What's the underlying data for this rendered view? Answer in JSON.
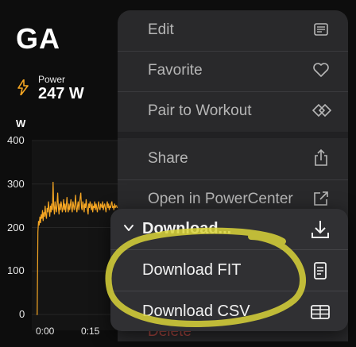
{
  "page": {
    "title": "GA",
    "power": {
      "label": "Power",
      "value": "247 W",
      "icon": "lightning-icon"
    },
    "unit": "W"
  },
  "chart_data": {
    "type": "line",
    "ylabel": "W",
    "yticks": [
      "400",
      "300",
      "200",
      "100",
      "0"
    ],
    "xticks": [
      "0:00",
      "0:15"
    ],
    "ylim": [
      0,
      400
    ],
    "series": [
      {
        "color": "#f5a623",
        "x_minutes": [
          0,
          0.2,
          0.4,
          0.6,
          0.8,
          1,
          1.2,
          1.4,
          1.6,
          1.8,
          2,
          2.2,
          2.4,
          2.6,
          2.8,
          3,
          3.2,
          3.4,
          3.6,
          3.8,
          4,
          4.2,
          4.4,
          4.6,
          4.8,
          5,
          5.2,
          5.4,
          5.6,
          5.8,
          6,
          6.2,
          6.4,
          6.6,
          6.8,
          7,
          7.2,
          7.4,
          7.6,
          7.8,
          8,
          8.2,
          8.4,
          8.6,
          8.8,
          9,
          9.2,
          9.4,
          9.6,
          9.8,
          10,
          10.2,
          10.4,
          10.6,
          10.8,
          11,
          11.2,
          11.4,
          11.6,
          11.8,
          12,
          12.2,
          12.4,
          12.6,
          12.8,
          13,
          13.2,
          13.4,
          13.6,
          13.8,
          14,
          14.2,
          14.4,
          14.6,
          14.8,
          15,
          15.2,
          15.4,
          15.6,
          15.8,
          16,
          16.2,
          16.4,
          16.6,
          16.8,
          17,
          17.2,
          17.4,
          17.6,
          17.8,
          18,
          18.2,
          18.4,
          18.6,
          18.8,
          19,
          19.2,
          19.4,
          19.6,
          19.8,
          20,
          20.2,
          20.4,
          20.6,
          20.8,
          21,
          21.2,
          21.4,
          21.6,
          21.8,
          22,
          22.2,
          22.4,
          22.6,
          22.8,
          23,
          23.2,
          23.4,
          23.6,
          23.8,
          24,
          24.2,
          24.4,
          24.6,
          24.8,
          25
        ],
        "values": [
          0,
          0,
          190,
          215,
          205,
          225,
          210,
          230,
          220,
          240,
          215,
          235,
          225,
          250,
          230,
          220,
          245,
          235,
          260,
          240,
          225,
          250,
          235,
          255,
          240,
          305,
          250,
          230,
          260,
          245,
          235,
          255,
          280,
          245,
          230,
          255,
          240,
          260,
          250,
          235,
          245,
          265,
          240,
          255,
          235,
          250,
          270,
          245,
          235,
          255,
          240,
          250,
          265,
          245,
          235,
          260,
          250,
          240,
          255,
          275,
          245,
          235,
          250,
          260,
          240,
          255,
          270,
          280,
          245,
          240,
          260,
          250,
          235,
          255,
          245,
          265,
          250,
          240,
          230,
          255,
          245,
          260,
          250,
          240,
          255,
          235,
          250,
          245,
          260,
          240,
          255,
          245,
          235,
          250,
          260,
          245,
          240,
          255,
          250,
          245,
          260,
          240,
          250,
          255,
          245,
          235,
          250,
          260,
          245,
          255,
          240,
          250,
          245,
          255,
          260,
          245,
          250,
          240,
          255,
          245,
          250,
          250,
          245
        ]
      }
    ]
  },
  "menu": {
    "items": [
      {
        "label": "Edit",
        "icon": "edit-icon"
      },
      {
        "label": "Favorite",
        "icon": "heart-icon"
      },
      {
        "label": "Pair to Workout",
        "icon": "pair-icon"
      },
      {
        "label": "Share",
        "icon": "share-icon"
      },
      {
        "label": "Open in PowerCenter",
        "icon": "open-external-icon"
      },
      {
        "label": "Delete",
        "icon": "trash-icon"
      }
    ]
  },
  "submenu": {
    "header": {
      "label": "Download...",
      "icon": "download-icon"
    },
    "items": [
      {
        "label": "Download FIT",
        "icon": "file-icon"
      },
      {
        "label": "Download CSV",
        "icon": "table-icon"
      }
    ]
  },
  "colors": {
    "accent": "#f5a623",
    "highlight": "#d9d33a",
    "menu_bg": "#2b2b2d"
  }
}
